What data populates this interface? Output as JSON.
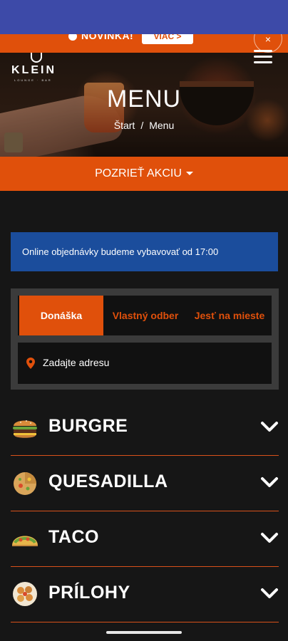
{
  "promo": {
    "badge_text": "NOVINKA!",
    "button_label": "VIAC >",
    "close_label": "×"
  },
  "brand": {
    "name": "KLEIN",
    "tagline": "LOUNGE · BAR"
  },
  "hero": {
    "title": "MENU",
    "breadcrumb": [
      "Štart",
      "/",
      "Menu"
    ]
  },
  "cta": {
    "label": "POZRIEŤ AKCIU"
  },
  "notice": {
    "text": "Online objednávky budeme vybavovať od 17:00",
    "color": "#1b4d9c"
  },
  "order": {
    "tabs": [
      {
        "label": "Donáška",
        "active": true
      },
      {
        "label": "Vlastný odber",
        "active": false
      },
      {
        "label": "Jesť na mieste",
        "active": false
      }
    ],
    "address_placeholder": "Zadajte adresu"
  },
  "categories": [
    {
      "label": "BURGRE",
      "icon": "burger-icon"
    },
    {
      "label": "QUESADILLA",
      "icon": "quesadilla-icon"
    },
    {
      "label": "TACO",
      "icon": "taco-icon"
    },
    {
      "label": "PRÍLOHY",
      "icon": "sides-icon"
    }
  ],
  "colors": {
    "accent": "#e0500b",
    "background": "#161616",
    "status_bar": "#3d4aa8"
  }
}
